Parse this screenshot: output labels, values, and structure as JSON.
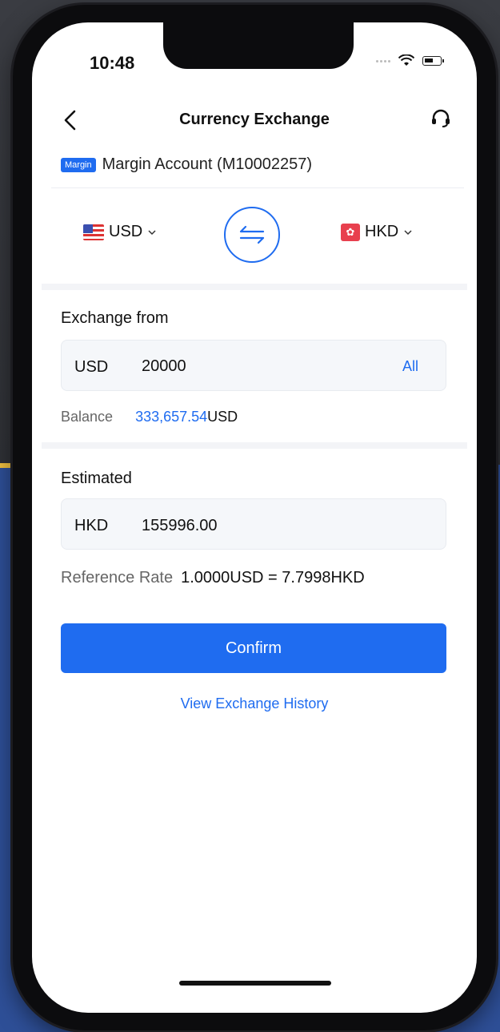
{
  "status_bar": {
    "time": "10:48"
  },
  "header": {
    "title": "Currency Exchange"
  },
  "account": {
    "badge": "Margin",
    "name": "Margin Account (M10002257)"
  },
  "exchange_pair": {
    "from_currency": "USD",
    "to_currency": "HKD"
  },
  "exchange_from": {
    "label": "Exchange from",
    "currency": "USD",
    "amount": "20000",
    "all_label": "All"
  },
  "balance": {
    "label": "Balance",
    "amount": "333,657.54",
    "unit": "USD"
  },
  "estimated": {
    "label": "Estimated",
    "currency": "HKD",
    "amount": "155996.00"
  },
  "reference_rate": {
    "label": "Reference Rate",
    "value": "1.0000USD = 7.7998HKD"
  },
  "actions": {
    "confirm_label": "Confirm",
    "history_label": "View Exchange History"
  },
  "colors": {
    "accent": "#1f6cf0",
    "field_bg": "#f5f7fa"
  }
}
